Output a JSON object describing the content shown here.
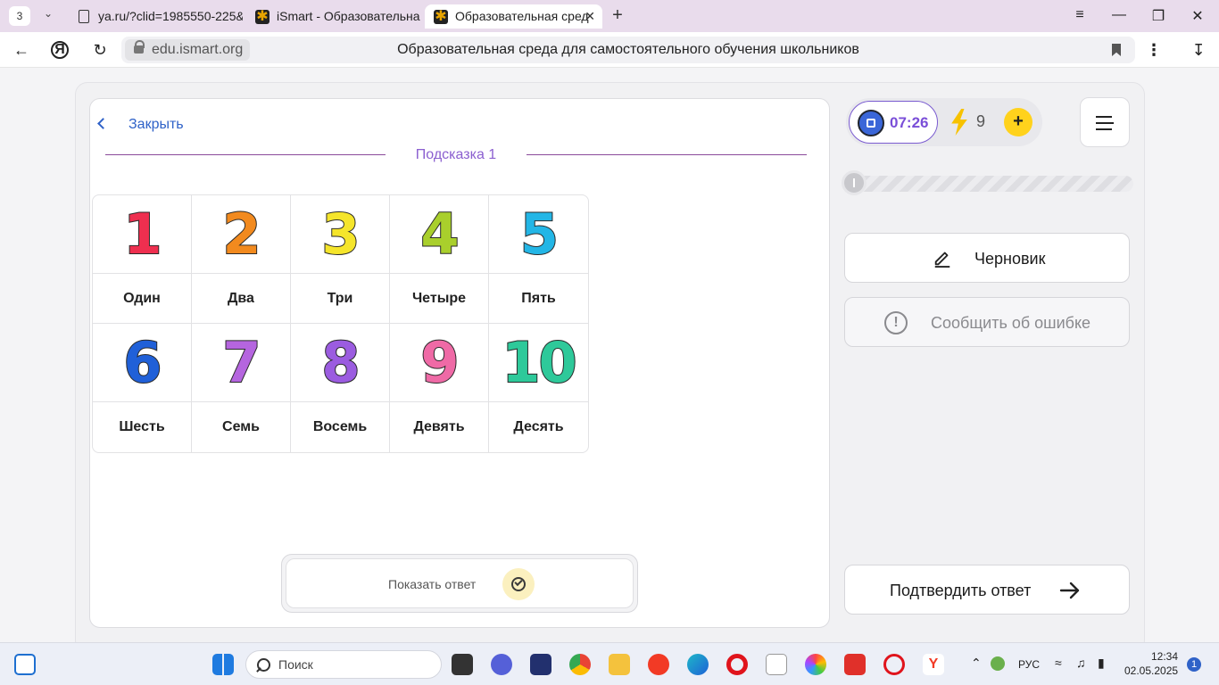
{
  "browser": {
    "tab_count": "3",
    "tabs": [
      {
        "title": "ya.ru/?clid=1985550-225&"
      },
      {
        "title": "iSmart - Образовательна"
      },
      {
        "title": "Образовательная сред"
      }
    ],
    "url": "edu.ismart.org",
    "page_title": "Образовательная среда для самостоятельного обучения школьников"
  },
  "task": {
    "close_label": "Закрыть",
    "hint_label": "Подсказка  1",
    "numbers": [
      {
        "digit": "1",
        "word": "Один",
        "color": "#ee2f4f"
      },
      {
        "digit": "2",
        "word": "Два",
        "color": "#f28a1e"
      },
      {
        "digit": "3",
        "word": "Три",
        "color": "#f5e52b"
      },
      {
        "digit": "4",
        "word": "Четыре",
        "color": "#a9cf2c"
      },
      {
        "digit": "5",
        "word": "Пять",
        "color": "#23b6e6"
      },
      {
        "digit": "6",
        "word": "Шесть",
        "color": "#2060d8"
      },
      {
        "digit": "7",
        "word": "Семь",
        "color": "#b565df"
      },
      {
        "digit": "8",
        "word": "Восемь",
        "color": "#9b5ce0"
      },
      {
        "digit": "9",
        "word": "Девять",
        "color": "#ef6aa6"
      },
      {
        "digit": "10",
        "word": "Десять",
        "color": "#2ec99a"
      }
    ],
    "show_answer_label": "Показать ответ"
  },
  "sidebar": {
    "timer": "07:26",
    "energy": "9",
    "progress": 0,
    "draft_label": "Черновик",
    "report_label": "Сообщить об ошибке",
    "confirm_label": "Подтвердить ответ"
  },
  "taskbar": {
    "search_placeholder": "Поиск",
    "language": "РУС",
    "time": "12:34",
    "date": "02.05.2025",
    "notifications": "1"
  },
  "colors": {
    "accent_purple": "#7a4ed8",
    "link_blue": "#2f62c8",
    "yellow": "#ffd21c"
  }
}
